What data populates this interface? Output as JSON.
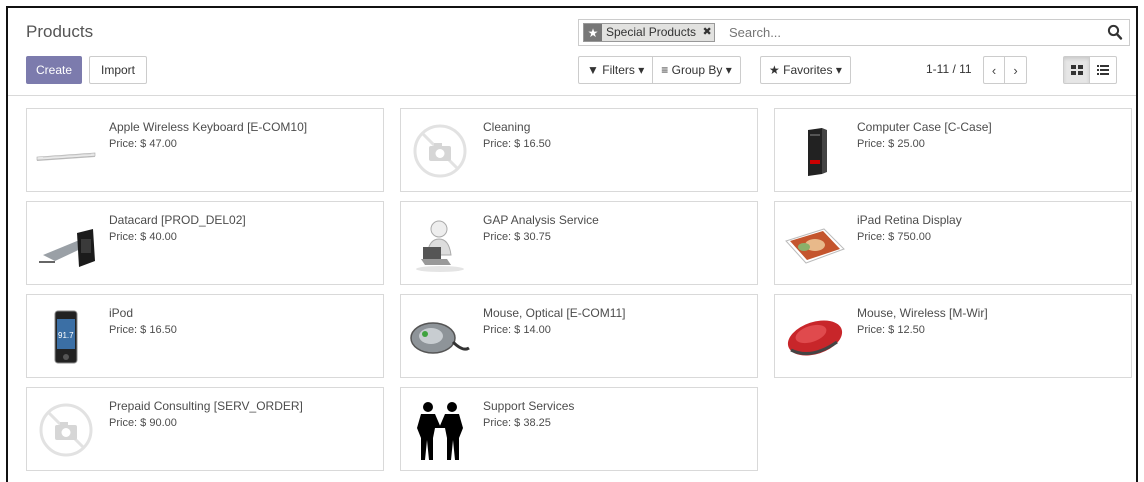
{
  "header": {
    "title": "Products",
    "create_label": "Create",
    "import_label": "Import"
  },
  "search": {
    "facet_label": "Special Products",
    "facet_icon": "star-icon",
    "placeholder": "Search...",
    "button_icon": "search-icon"
  },
  "filters": {
    "filters_label": "Filters",
    "group_by_label": "Group By",
    "favorites_label": "Favorites"
  },
  "pager": {
    "value": "1-11 / 11"
  },
  "colors": {
    "primary": "#7c7bad",
    "border": "#d9d9d9",
    "text": "#4c4c4c"
  },
  "products": [
    {
      "name": "Apple Wireless Keyboard [E-COM10]",
      "price": "Price: $ 47.00",
      "image": "keyboard"
    },
    {
      "name": "Cleaning",
      "price": "Price: $ 16.50",
      "image": "no-image"
    },
    {
      "name": "Computer Case [C-Case]",
      "price": "Price: $ 25.00",
      "image": "computer-case"
    },
    {
      "name": "Datacard [PROD_DEL02]",
      "price": "Price: $ 40.00",
      "image": "datacard"
    },
    {
      "name": "GAP Analysis Service",
      "price": "Price: $ 30.75",
      "image": "gap-analysis"
    },
    {
      "name": "iPad Retina Display",
      "price": "Price: $ 750.00",
      "image": "ipad"
    },
    {
      "name": "iPod",
      "price": "Price: $ 16.50",
      "image": "ipod"
    },
    {
      "name": "Mouse, Optical [E-COM11]",
      "price": "Price: $ 14.00",
      "image": "optical-mouse"
    },
    {
      "name": "Mouse, Wireless [M-Wir]",
      "price": "Price: $ 12.50",
      "image": "wireless-mouse"
    },
    {
      "name": "Prepaid Consulting [SERV_ORDER]",
      "price": "Price: $ 90.00",
      "image": "no-image"
    },
    {
      "name": "Support Services",
      "price": "Price: $ 38.25",
      "image": "handshake"
    }
  ]
}
